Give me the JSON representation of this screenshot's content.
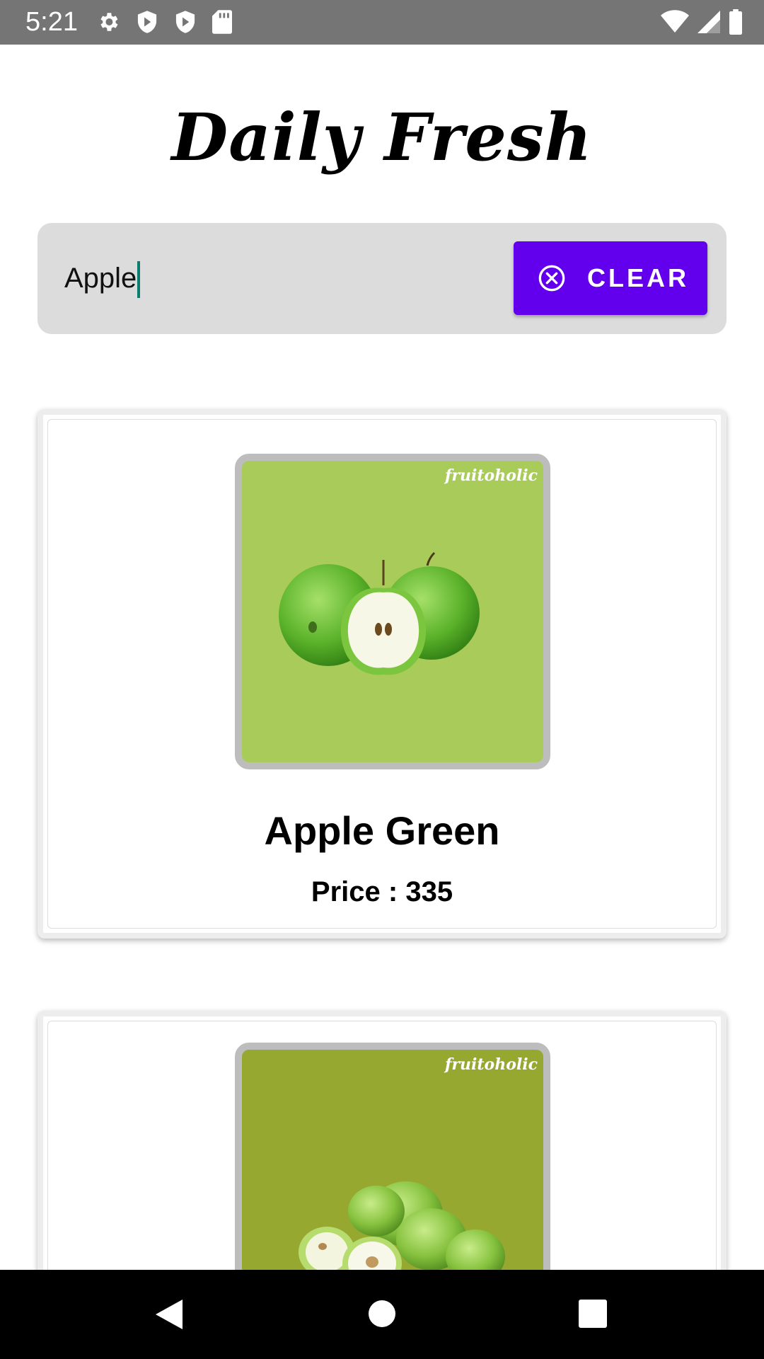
{
  "status_bar": {
    "time": "5:21",
    "left_icons": [
      "gear-icon",
      "shield-icon",
      "shield-icon",
      "sd-card-icon"
    ],
    "right_icons": [
      "wifi-icon",
      "signal-icon",
      "battery-icon"
    ]
  },
  "app": {
    "title": "Daily Fresh"
  },
  "search": {
    "value": "Apple",
    "clear_label": "CLEAR",
    "clear_icon": "close-circle-icon",
    "accent_color": "#6200ee"
  },
  "products": [
    {
      "name": "Apple Green",
      "price_text": "Price : 335",
      "image_brand": "fruitoholic",
      "image_bg": "#a9cb5a"
    },
    {
      "name": "",
      "price_text": "",
      "image_brand": "fruitoholic",
      "image_bg": "#97a831"
    }
  ],
  "nav_bar": {
    "buttons": [
      "back-icon",
      "home-icon",
      "recents-icon"
    ]
  }
}
